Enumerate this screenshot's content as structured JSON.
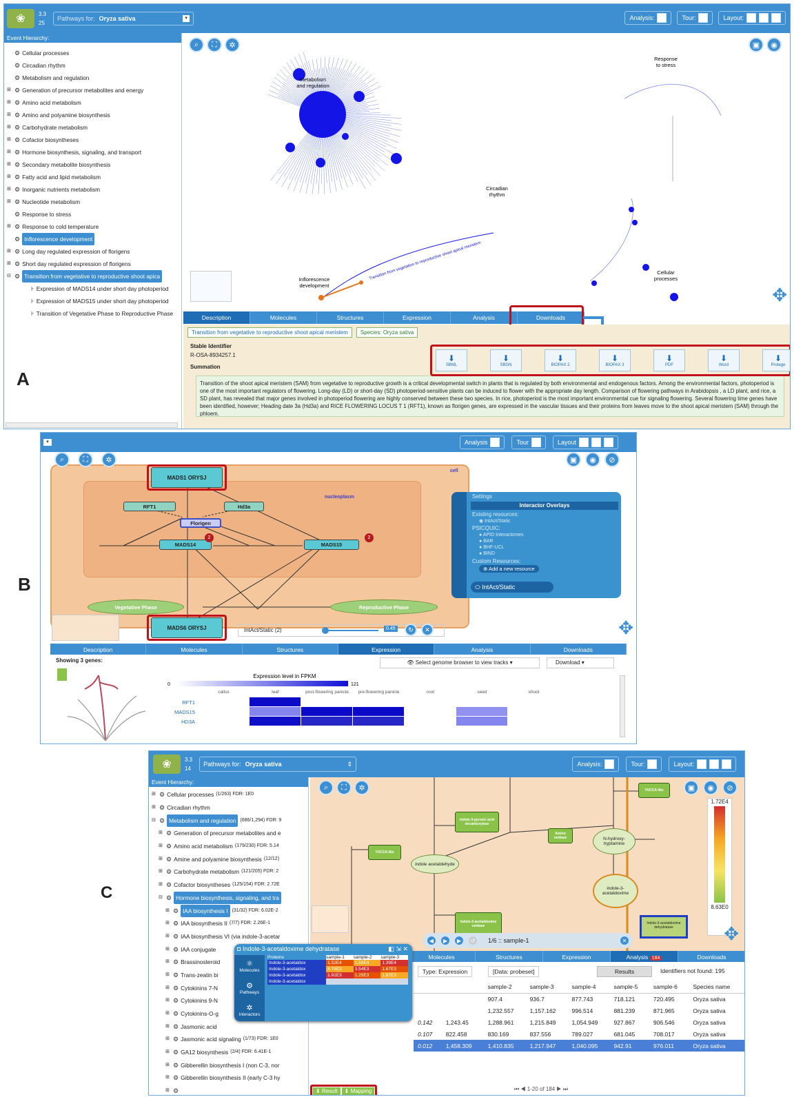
{
  "labels": {
    "a": "A",
    "b": "B",
    "c": "C"
  },
  "panelA": {
    "logo_badges": [
      "3.3",
      "25"
    ],
    "pathways_for": "Pathways for:",
    "species": "Oryza sativa",
    "analysis": "Analysis:",
    "tour": "Tour:",
    "layout": "Layout:",
    "hier_title": "Event Hierarchy:",
    "hier": [
      {
        "pm": "",
        "label": "Cellular processes"
      },
      {
        "pm": "",
        "label": "Circadian rhythm"
      },
      {
        "pm": "",
        "label": "Metabolism and regulation"
      },
      {
        "pm": "⊞",
        "label": "Generation of precursor metabolites and energy"
      },
      {
        "pm": "⊞",
        "label": "Amino acid metabolism"
      },
      {
        "pm": "⊞",
        "label": "Amino and polyamine biosynthesis"
      },
      {
        "pm": "⊞",
        "label": "Carbohydrate metabolism"
      },
      {
        "pm": "⊞",
        "label": "Cofactor biosyntheses"
      },
      {
        "pm": "⊞",
        "label": "Hormone biosynthesis, signaling, and transport"
      },
      {
        "pm": "⊞",
        "label": "Secondary metabolite biosynthesis"
      },
      {
        "pm": "⊞",
        "label": "Fatty acid and lipid metabolism"
      },
      {
        "pm": "⊞",
        "label": "Inorganic nutrients metabolism"
      },
      {
        "pm": "⊞",
        "label": "Nucleotide metabolism"
      },
      {
        "pm": "",
        "label": "Response to stress"
      },
      {
        "pm": "⊞",
        "label": "Response to cold temperature"
      },
      {
        "pm": "",
        "label": "Inflorescence development",
        "sel": true
      },
      {
        "pm": "⊞",
        "label": "Long day regulated expression of florigens"
      },
      {
        "pm": "⊞",
        "label": "Short day regulated expression of florigens"
      },
      {
        "pm": "⊟",
        "label": "Transition from vegetative to reproductive shoot apica",
        "sel": true
      },
      {
        "pm": "",
        "label": "Expression of MADS14 under short day photoperiod",
        "leaf": true
      },
      {
        "pm": "",
        "label": "Expression of MADS15 under short day photoperiod",
        "leaf": true
      },
      {
        "pm": "",
        "label": "Transition of Vegetative Phase to Reproductive Phase",
        "leaf": true
      }
    ],
    "burst_labels": {
      "metab": "Metabolism\nand regulation",
      "stress": "Response\nto stress",
      "circ": "Circadian\nrhythm",
      "cell": "Cellular\nprocesses",
      "inflo": "Inflorescence\ndevelopment",
      "trans": "Transition from vegetative to reproductive shoot apical meristem"
    },
    "tabs": [
      "Description",
      "Molecules",
      "Structures",
      "Expression",
      "Analysis",
      "Downloads"
    ],
    "pathway_name": "Transition from vegetative to reproductive shoot apical meristem",
    "species_tag": "Species: Oryza sativa",
    "stable_id_label": "Stable Identifier",
    "stable_id": "R-OSA-8934257.1",
    "summation_label": "Summation",
    "summation": "Transition of the shoot apical meristem (SAM) from vegetative to reproductive growth is a critical developmental switch in plants that is regulated by both environmental and endogenous factors. Among the environmental factors, photoperiod is one of the most important regulators of flowering. Long-day (LD) or short-day (SD) photoperiod-sensitive plants can be induced to flower with the appropriate day length. Comparison of flowering pathways in Arabidopsis , a LD plant, and rice, a SD plant, has revealed that major genes involved in photoperiod flowering are highly conserved between these two species. In rice, photoperiod is the most important environmental cue for signaling flowering. Several flowering time genes have been identified, however; Heading date 3a (Hd3a) and RICE FLOWERING LOCUS T 1 (RFT1), known as florigen genes, are expressed in the vascular tissues and their proteins from leaves move to the shoot apical meristem (SAM) through the phloem.",
    "downloads": [
      "SBML",
      "SBGN",
      "BIOPAX 2",
      "BIOPAX 3",
      "PDF",
      "Word",
      "Protege"
    ]
  },
  "panelB": {
    "analysis": "Analysis",
    "tour": "Tour",
    "layout": "Layout",
    "nodes": {
      "mads1": "MADS1 ORYSJ",
      "mads6": "MADS6 ORYSJ",
      "rft1": "RFT1",
      "hd3a": "Hd3a",
      "florigen": "Florigen",
      "mads14": "MADS14",
      "mads15": "MADS15",
      "veg": "Vegetative Phase",
      "rep": "Reproductive Phase",
      "cell": "cell",
      "nucleo": "nucleoplasm",
      "badge": "2"
    },
    "settings": {
      "title": "Settings",
      "overlays": "Interactor Overlays",
      "existing": "Existing resources:",
      "intact": "IntAct/Static",
      "psicquic": "PSICQUIC:",
      "list": [
        "APID Interactomes",
        "BAR",
        "BHF-UCL",
        "BIND"
      ],
      "custom": "Custom Resources:",
      "add": "Add a new resource",
      "footer": "IntAct/Static"
    },
    "intact_count": "IntAct/Static (2)",
    "slider_val": "0.45",
    "tabs": [
      "Description",
      "Molecules",
      "Structures",
      "Expression",
      "Analysis",
      "Downloads"
    ],
    "showing": "Showing 3 genes:",
    "genome_btn": "Select genome browser to view tracks",
    "download": "Download",
    "expr_title": "Expression level in FPKM",
    "scale_min": "0",
    "scale_max": "121",
    "tissues": [
      "callus",
      "leaf",
      "post-flowering panicle",
      "pre-flowering panicle",
      "root",
      "seed",
      "shoot"
    ],
    "genes": [
      "RFT1",
      "MADS15",
      "HD3A"
    ],
    "heat": [
      [
        0,
        0.95,
        0,
        0,
        0,
        0,
        0
      ],
      [
        0,
        0.35,
        0.9,
        0.9,
        0,
        0.3,
        0
      ],
      [
        0,
        0.85,
        0.75,
        0.75,
        0,
        0.35,
        0
      ]
    ]
  },
  "panelC": {
    "logo_badges": [
      "3.3",
      "14"
    ],
    "pathways_for": "Pathways for:",
    "species": "Oryza sativa",
    "analysis": "Analysis:",
    "tour": "Tour:",
    "layout": "Layout:",
    "hier_title": "Event Hierarchy:",
    "hier": [
      {
        "pm": "⊞",
        "label": "Cellular processes",
        "stat": "(1/263) FDR: 1E0"
      },
      {
        "pm": "⊞",
        "label": "Circadian rhythm",
        "stat": ""
      },
      {
        "pm": "⊟",
        "label": "Metabolism and regulation",
        "stat": "(686/1,294) FDR: 9",
        "sel": true
      },
      {
        "pm": "⊞",
        "label": "Generation of precursor metabolites and e",
        "stat": "",
        "ind": 1
      },
      {
        "pm": "⊞",
        "label": "Amino acid metabolism",
        "stat": "(179/230) FDR: 5.14",
        "ind": 1
      },
      {
        "pm": "⊞",
        "label": "Amine and polyamine biosynthesis",
        "stat": "(12/12)",
        "ind": 1
      },
      {
        "pm": "⊞",
        "label": "Carbohydrate metabolism",
        "stat": "(121/205) FDR: 2",
        "ind": 1
      },
      {
        "pm": "⊞",
        "label": "Cofactor biosyntheses",
        "stat": "(125/154) FDR: 2.72E",
        "ind": 1
      },
      {
        "pm": "⊟",
        "label": "Hormone biosynthesis, signaling, and tra",
        "stat": "",
        "ind": 1,
        "sel": true
      },
      {
        "pm": "⊞",
        "label": "IAA biosynthesis I",
        "stat": "(31/32) FDR: 6.02E-2",
        "ind": 2,
        "sel": true
      },
      {
        "pm": "⊞",
        "label": "IAA biosynthesis II",
        "stat": "(7/7) FDR: 2.26E-1",
        "ind": 2
      },
      {
        "pm": "⊞",
        "label": "IAA biosynthesis VI (via indole-3-acetar",
        "stat": "",
        "ind": 2
      },
      {
        "pm": "⊞",
        "label": "IAA conjugate",
        "stat": "",
        "ind": 2
      },
      {
        "pm": "⊞",
        "label": "Brassinosteroid",
        "stat": "",
        "ind": 2
      },
      {
        "pm": "⊞",
        "label": "Trans-zeatin bi",
        "stat": "",
        "ind": 2
      },
      {
        "pm": "⊞",
        "label": "Cytokinins 7-N",
        "stat": "",
        "ind": 2
      },
      {
        "pm": "⊞",
        "label": "Cytokinins 9-N",
        "stat": "",
        "ind": 2
      },
      {
        "pm": "⊞",
        "label": "Cytokinins-O-g",
        "stat": "",
        "ind": 2
      },
      {
        "pm": "⊞",
        "label": "Jasmonic acid",
        "stat": "",
        "ind": 2
      },
      {
        "pm": "⊞",
        "label": "Jasmonic acid signaling",
        "stat": "(1/73) FDR: 1E0",
        "ind": 2
      },
      {
        "pm": "⊞",
        "label": "GA12 biosynthesis",
        "stat": "(2/4) FDR: 6.41E-1",
        "ind": 2
      },
      {
        "pm": "⊞",
        "label": "Gibberellin biosynthesis I (non C-3, nor",
        "stat": "",
        "ind": 2
      },
      {
        "pm": "⊞",
        "label": "Gibberellin biosynthesis II (early C-3 hy",
        "stat": "",
        "ind": 2
      },
      {
        "pm": "⊞",
        "label": "",
        "stat": "",
        "ind": 2
      }
    ],
    "legend_max": "1.72E4",
    "legend_min": "8.63E0",
    "player": "1/6 :: sample-1",
    "tabs": [
      "Molecules",
      "Structures",
      "Expression",
      "Analysis",
      "Downloads"
    ],
    "analysis_badge": "184",
    "filter_type": "Type: Expression",
    "filter_data": "[Data: probeset]",
    "results_btn": "Results",
    "not_found": "Identifiers not found: 195",
    "table_head": [
      "",
      "",
      "sample-2",
      "sample-3",
      "sample-4",
      "sample-5",
      "sample-6",
      "Species name"
    ],
    "table_rows": [
      [
        "",
        "",
        "907.4",
        "936.7",
        "877.743",
        "718.121",
        "720.495",
        "Oryza sativa"
      ],
      [
        "",
        "",
        "1,232.557",
        "1,157.162",
        "996.514",
        "881.239",
        "871.965",
        "Oryza sativa"
      ],
      [
        "0.142",
        "1,243.45",
        "1,288.961",
        "1,215.849",
        "1,054.949",
        "927.867",
        "906.546",
        "Oryza sativa"
      ],
      [
        "0.107",
        "822.458",
        "830.169",
        "837.556",
        "789.027",
        "681.045",
        "708.017",
        "Oryza sativa"
      ],
      [
        "0.012",
        "1,458.309",
        "1,410.835",
        "1,217.947",
        "1,040.095",
        "942.91",
        "976.011",
        "Oryza sativa"
      ]
    ],
    "pager": "1-20 of 184",
    "popup": {
      "title": "Indole-3-acetaldoxime dehydratase",
      "cols": [
        "Proteins",
        "sample-1",
        "sample-2",
        "sample-3"
      ],
      "side": [
        "Molecules",
        "Pathways",
        "Interactors"
      ],
      "rows": [
        [
          "Indole-3-acetaldox",
          "1.52E4",
          "1.59E4",
          "1.39E4"
        ],
        [
          "Indole-3-acetaldox",
          "4.74E3",
          "3.54E3",
          "1.67E3"
        ],
        [
          "Indole-3-acetaldox",
          "1.91E3",
          "1.25E3",
          "1.87E3"
        ],
        [
          "Indole-3-acetaldox",
          "",
          "",
          ""
        ]
      ],
      "result": "Result",
      "mapping": "Mapping"
    },
    "nodes": {
      "yucca1": "YUCCA like",
      "yucca2": "YUCCA like",
      "ipa": "indole-3-pyruvic acid decarboxylase",
      "amino": "Amino oxidase",
      "n_hydrox": "N-hydroxy-tryptamine",
      "iaald": "indole acetaldehyde",
      "iaa": "indole-3-acetaldoxime",
      "iaox": "Indole-3-acetaldoxime dehydratase",
      "box": "Indole-3-acetaldoxime oxidase"
    }
  }
}
